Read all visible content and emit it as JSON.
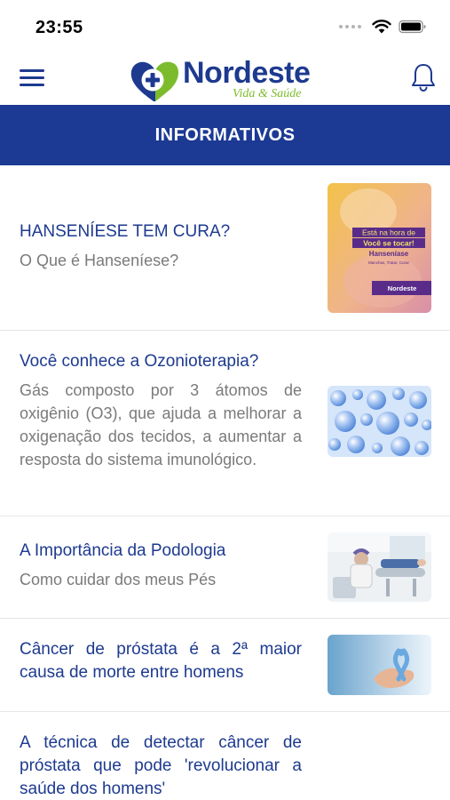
{
  "status": {
    "time": "23:55"
  },
  "header": {
    "logo_title": "Nordeste",
    "logo_subtitle": "Vida & Saúde"
  },
  "section": {
    "title": "INFORMATIVOS"
  },
  "items": [
    {
      "title": "HANSENÍESE TEM CURA?",
      "description": "O Que é Hanseníese?",
      "thumb_text_1": "Está na hora de",
      "thumb_text_2": "Você se tocar!",
      "thumb_text_3": "Hanseníase",
      "thumb_text_4": "Manchas, Tratar, Curar",
      "thumb_logo": "Nordeste"
    },
    {
      "title": "Você conhece a Ozonioterapia?",
      "description": "Gás composto por 3 átomos de oxigênio (O3), que ajuda a melhorar a oxigenação dos tecidos, a aumentar a resposta do sistema imunológico."
    },
    {
      "title": "A Importância da Podologia",
      "description": "Como cuidar dos meus Pés"
    },
    {
      "title": "Câncer de próstata é a 2ª maior causa de morte entre homens",
      "description": ""
    },
    {
      "title": "A técnica de detectar câncer de próstata que pode 'revolucionar a saúde dos homens'",
      "description": ""
    }
  ],
  "colors": {
    "primary": "#1c3a93",
    "accent": "#7cbc2c",
    "muted_text": "#7a7a7a"
  }
}
